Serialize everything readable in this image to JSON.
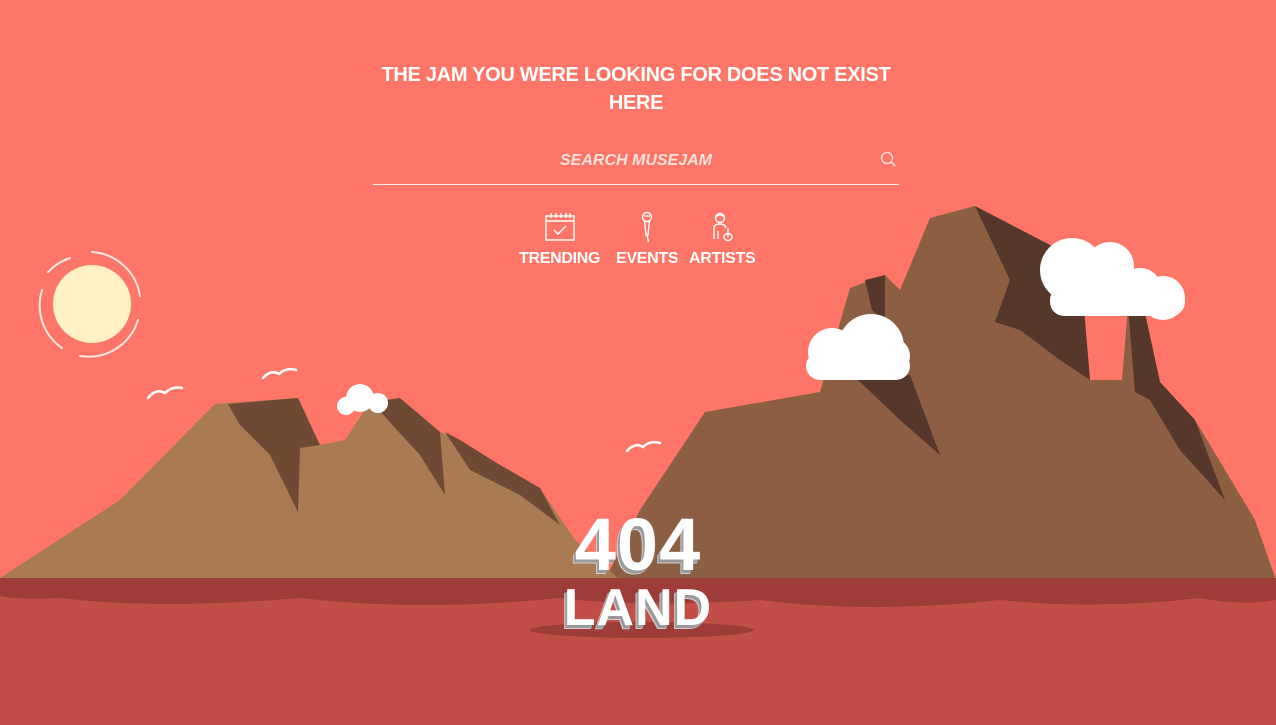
{
  "page": {
    "headline": "THE JAM YOU WERE LOOKING FOR DOES NOT EXIST HERE",
    "error_code": "404",
    "error_word": "LAND"
  },
  "search": {
    "placeholder": "SEARCH MUSEJAM",
    "value": "",
    "icon": "search-icon"
  },
  "nav": {
    "items": [
      {
        "label": "TRENDING",
        "icon": "calendar-check-icon"
      },
      {
        "label": "EVENTS",
        "icon": "microphone-icon"
      },
      {
        "label": "ARTISTS",
        "icon": "artist-icon"
      }
    ]
  },
  "colors": {
    "sky": "#ff7668",
    "ground": "#c24e48",
    "horizon_shadow": "#9e3d38",
    "rock_light": "#a87b55",
    "rock_dark": "#8c5e42",
    "rock_shadow": "#553829",
    "sun": "#fff1c3",
    "text": "#ffffff"
  }
}
